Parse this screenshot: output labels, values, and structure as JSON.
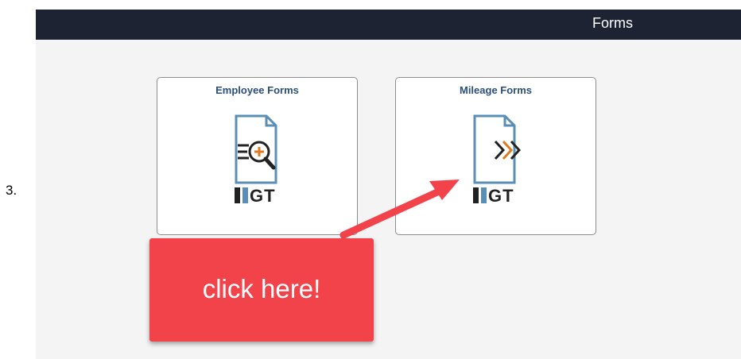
{
  "step": {
    "number": "3."
  },
  "header": {
    "title": "Forms"
  },
  "tiles": [
    {
      "title": "Employee Forms",
      "icon": "document-search-icon",
      "logo_text": "GT"
    },
    {
      "title": "Mileage Forms",
      "icon": "document-forward-icon",
      "logo_text": "GT"
    }
  ],
  "callout": {
    "text": "click here!"
  },
  "colors": {
    "header_bg": "#1d2333",
    "tile_title": "#2b4f7c",
    "icon_doc": "#5a8eb6",
    "accent_orange": "#e07a1f",
    "logo_dark": "#222222",
    "callout_bg": "#f2434b"
  }
}
